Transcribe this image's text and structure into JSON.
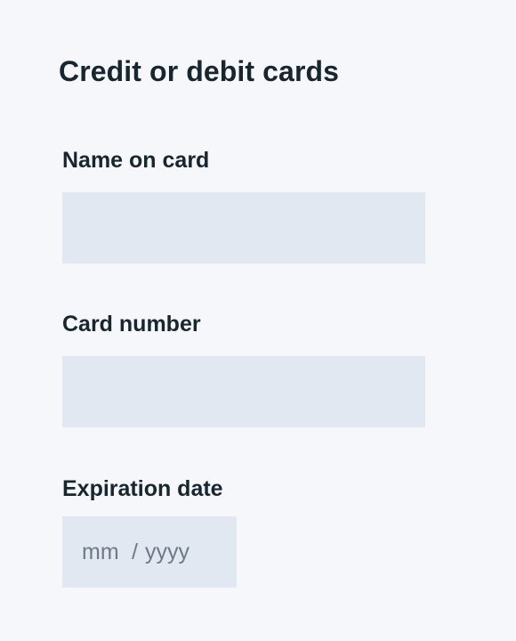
{
  "form": {
    "title": "Credit or debit cards",
    "name_on_card": {
      "label": "Name on card",
      "value": "",
      "placeholder": ""
    },
    "card_number": {
      "label": "Card number",
      "value": "",
      "placeholder": ""
    },
    "expiration_date": {
      "label": "Expiration date",
      "month_placeholder": "mm",
      "separator": "/",
      "year_placeholder": "yyyy"
    }
  },
  "colors": {
    "background": "#f5f7fb",
    "field_background": "#e1e8f2",
    "text": "#17262f",
    "placeholder": "#6e7a86"
  }
}
